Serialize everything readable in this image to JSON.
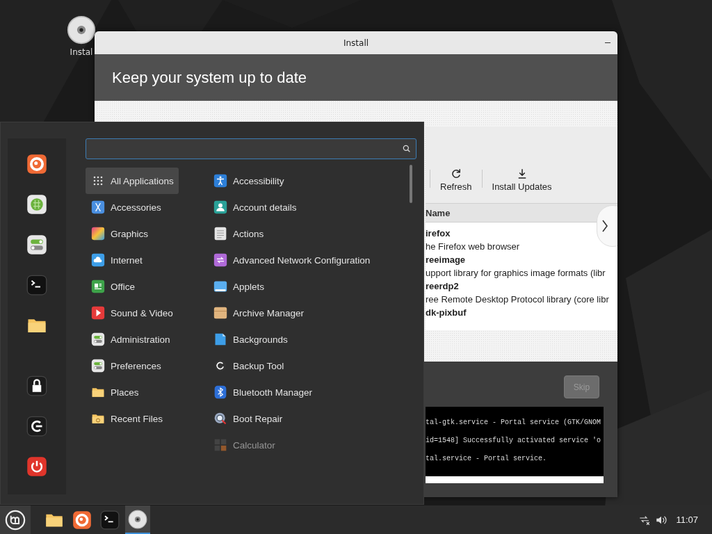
{
  "desktop": {
    "icons": [
      {
        "label": "Instal",
        "kind": "disc"
      }
    ]
  },
  "window": {
    "title": "Install",
    "heading": "Keep your system up to date",
    "toolbar": [
      {
        "label": "Refresh",
        "kind": "refresh"
      },
      {
        "label": "Install Updates",
        "kind": "download"
      }
    ],
    "table": {
      "columns": [
        "Name"
      ],
      "rows": [
        {
          "name": "irefox",
          "description": "he Firefox web browser"
        },
        {
          "name": "reeimage",
          "description": "upport library for graphics image formats (libr"
        },
        {
          "name": "reerdp2",
          "description": "ree Remote Desktop Protocol library (core libr"
        },
        {
          "name": "dk-pixbuf"
        }
      ]
    },
    "skip_button": {
      "label": "Skip",
      "disabled": true
    },
    "terminal": {
      "lines": [
        "tal-gtk.service - Portal service (GTK/GNOM",
        "id=1548] Successfully activated service 'o",
        "tal.service - Portal service."
      ]
    }
  },
  "menu": {
    "favorites": [
      {
        "kind": "firefox"
      },
      {
        "kind": "software"
      },
      {
        "kind": "toggles"
      },
      {
        "kind": "terminal"
      },
      {
        "kind": "folder"
      },
      {
        "kind": "lock"
      },
      {
        "kind": "logout"
      },
      {
        "kind": "power"
      }
    ],
    "categories": [
      {
        "label": "All Applications",
        "kind": "grid",
        "selected": true
      },
      {
        "label": "Accessories",
        "kind": "scissors",
        "selected": false
      },
      {
        "label": "Graphics",
        "kind": "graphics",
        "selected": false
      },
      {
        "label": "Internet",
        "kind": "cloud",
        "selected": false
      },
      {
        "label": "Office",
        "kind": "office",
        "selected": false
      },
      {
        "label": "Sound & Video",
        "kind": "play",
        "selected": false
      },
      {
        "label": "Administration",
        "kind": "toggles",
        "selected": false
      },
      {
        "label": "Preferences",
        "kind": "prefs",
        "selected": false
      },
      {
        "label": "Places",
        "kind": "folder",
        "selected": false
      },
      {
        "label": "Recent Files",
        "kind": "recent",
        "selected": false
      }
    ],
    "apps": [
      {
        "label": "Accessibility",
        "kind": "accessibility",
        "faded": false
      },
      {
        "label": "Account details",
        "kind": "person",
        "faded": false
      },
      {
        "label": "Actions",
        "kind": "list",
        "faded": false
      },
      {
        "label": "Advanced Network Configuration",
        "kind": "network",
        "faded": false
      },
      {
        "label": "Applets",
        "kind": "applets",
        "faded": false
      },
      {
        "label": "Archive Manager",
        "kind": "archive",
        "faded": false
      },
      {
        "label": "Backgrounds",
        "kind": "page",
        "faded": false
      },
      {
        "label": "Backup Tool",
        "kind": "backup",
        "faded": false
      },
      {
        "label": "Bluetooth Manager",
        "kind": "bluetooth",
        "faded": false
      },
      {
        "label": "Boot Repair",
        "kind": "bootrepair",
        "faded": false
      },
      {
        "label": "Calculator",
        "kind": "calculator",
        "faded": true
      }
    ]
  },
  "taskbar": {
    "launchers": [
      {
        "kind": "folder",
        "active": false
      },
      {
        "kind": "firefox",
        "active": false
      },
      {
        "kind": "terminal",
        "active": false
      },
      {
        "kind": "disc",
        "active": true
      }
    ],
    "clock": "11:07"
  }
}
